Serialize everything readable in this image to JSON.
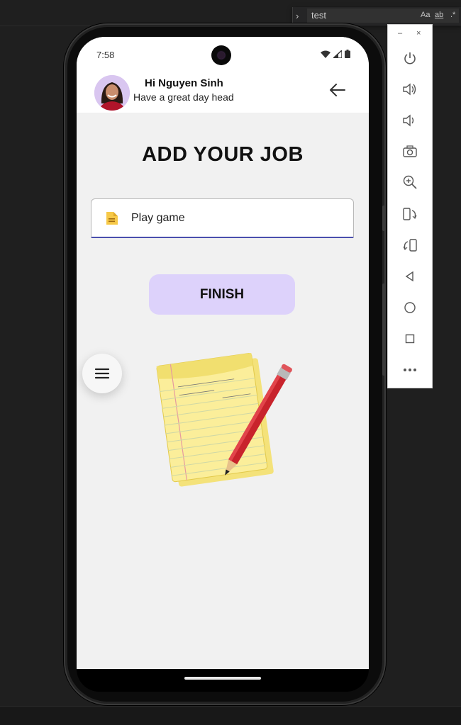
{
  "editor": {
    "find_toggle": "›",
    "find_value": "test",
    "options": [
      "Aa",
      "ab",
      ".*"
    ]
  },
  "status": {
    "time": "7:58"
  },
  "header": {
    "name": "Hi Nguyen Sinh",
    "subtitle": "Have a great day head"
  },
  "page": {
    "title": "ADD YOUR JOB",
    "job_value": "Play game",
    "finish_label": "FINISH"
  },
  "emulator": {
    "minimize": "–",
    "close": "×",
    "controls": [
      "power-icon",
      "volume-up-icon",
      "volume-down-icon",
      "camera-icon",
      "zoom-in-icon",
      "rotate-left-icon",
      "rotate-right-icon",
      "back-icon",
      "home-icon",
      "overview-icon",
      "more-icon"
    ]
  },
  "colors": {
    "accent_button": "#ddd2fb",
    "input_underline": "#4a4fae",
    "screen_bg": "#f1f1f1"
  }
}
